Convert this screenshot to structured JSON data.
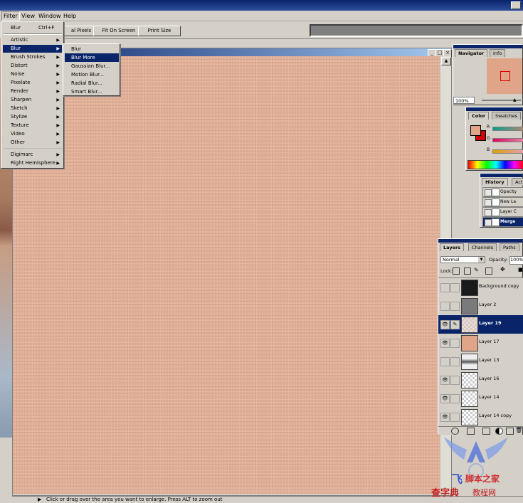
{
  "menubar": {
    "items": [
      "Filter",
      "View",
      "Window",
      "Help"
    ]
  },
  "optionsbar": {
    "buttons": [
      "al Pixels",
      "Fit On Screen",
      "Print Size"
    ]
  },
  "filter_menu": {
    "top_item": {
      "label": "Blur",
      "shortcut": "Ctrl+F"
    },
    "items": [
      "Artistic",
      "Blur",
      "Brush Strokes",
      "Distort",
      "Noise",
      "Pixelate",
      "Render",
      "Sharpen",
      "Sketch",
      "Stylize",
      "Texture",
      "Video",
      "Other"
    ],
    "bottom_items": [
      "Digimarc",
      "Right Hemisphere"
    ],
    "selected": "Blur"
  },
  "blur_submenu": {
    "items": [
      "Blur",
      "Blur More",
      "Gaussian Blur...",
      "Motion Blur...",
      "Radial Blur...",
      "Smart Blur..."
    ],
    "selected": "Blur More"
  },
  "navigator": {
    "tabs": [
      "Navigator",
      "Info"
    ],
    "zoom": "100%"
  },
  "color_palette": {
    "tabs": [
      "Color",
      "Swatches"
    ],
    "channels": [
      "R",
      "G",
      "B"
    ],
    "fg_color": "#e0a488",
    "bg_color": "#cc0000"
  },
  "history": {
    "tabs": [
      "History",
      "Acti"
    ],
    "items": [
      "Opacity",
      "New La",
      "Layer C",
      "Merge"
    ],
    "selected": "Merge"
  },
  "layers": {
    "tabs": [
      "Layers",
      "Channels",
      "Paths"
    ],
    "blend_mode": "Normal",
    "opacity_label": "Opacity:",
    "opacity_value": "100%",
    "lock_label": "Lock:",
    "rows": [
      {
        "name": "Background copy",
        "visible": false,
        "thumb": "dark"
      },
      {
        "name": "Layer 2",
        "visible": false,
        "thumb": "gray"
      },
      {
        "name": "Layer 19",
        "visible": true,
        "thumb": "checker-pink",
        "selected": true
      },
      {
        "name": "Layer 17",
        "visible": true,
        "thumb": "skin"
      },
      {
        "name": "Layer 13",
        "visible": false,
        "thumb": "lips"
      },
      {
        "name": "Layer 16",
        "visible": true,
        "thumb": "checker"
      },
      {
        "name": "Layer 14",
        "visible": true,
        "thumb": "checker"
      },
      {
        "name": "Layer 14 copy",
        "visible": true,
        "thumb": "checker"
      }
    ]
  },
  "status": {
    "text": "Click or drag over the area you want to enlarge. Press ALT to zoom out"
  },
  "watermark": {
    "text1": "飞",
    "text2": "脚本之家",
    "text3": "查字典",
    "text4": "教程网"
  }
}
